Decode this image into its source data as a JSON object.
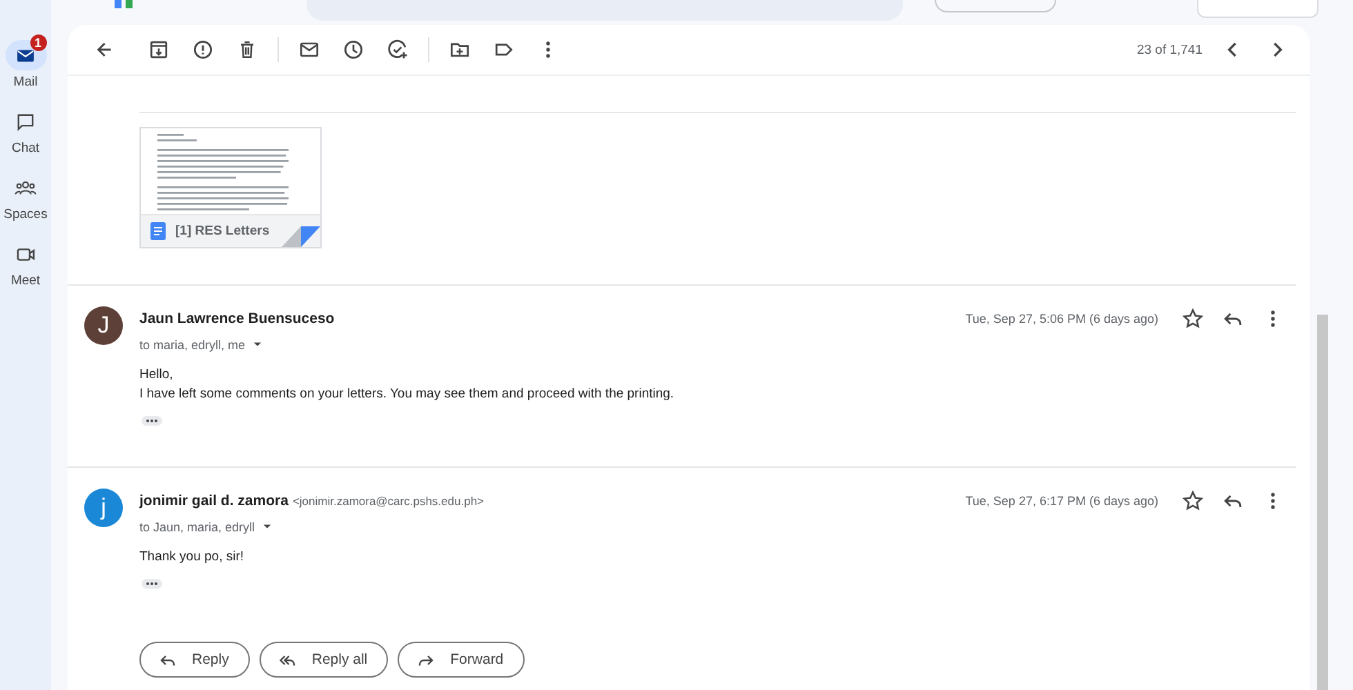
{
  "nav": [
    {
      "label": "Mail",
      "selected": true,
      "badge": "1"
    },
    {
      "label": "Chat",
      "selected": false
    },
    {
      "label": "Spaces",
      "selected": false
    },
    {
      "label": "Meet",
      "selected": false
    }
  ],
  "toolbar": {
    "counter": "23 of 1,741"
  },
  "attachment": {
    "name": "[1] RES Letters"
  },
  "messages": [
    {
      "avatar": "J",
      "color": "#5d4037",
      "sender": "Jaun Lawrence Buensuceso",
      "recipients": "to maria, edryll, me",
      "date": "Tue, Sep 27, 5:06 PM (6 days ago)",
      "starred": false,
      "body": [
        "Hello,",
        "I have left some comments on your letters. You may see them and proceed with the printing."
      ]
    },
    {
      "avatar": "j",
      "color": "#1a88d6",
      "sender": "jonimir gail d. zamora",
      "email": "<jonimir.zamora@carc.pshs.edu.ph>",
      "recipients": "to Jaun, maria, edryll",
      "date": "Tue, Sep 27, 6:17 PM (6 days ago)",
      "starred": false,
      "body": [
        "Thank you po, sir!"
      ]
    }
  ],
  "actions": [
    {
      "kind": "reply",
      "label": "Reply"
    },
    {
      "kind": "reply_all",
      "label": "Reply all"
    },
    {
      "kind": "forward",
      "label": "Forward"
    }
  ]
}
